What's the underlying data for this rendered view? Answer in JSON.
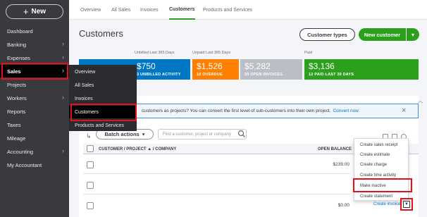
{
  "sidebar": {
    "new_label": "New",
    "items": [
      {
        "label": "Dashboard",
        "chevron": false
      },
      {
        "label": "Banking",
        "chevron": true
      },
      {
        "label": "Expenses",
        "chevron": true
      },
      {
        "label": "Sales",
        "chevron": true
      },
      {
        "label": "Projects",
        "chevron": false
      },
      {
        "label": "Workers",
        "chevron": true
      },
      {
        "label": "Reports",
        "chevron": false
      },
      {
        "label": "Taxes",
        "chevron": false
      },
      {
        "label": "Mileage",
        "chevron": false
      },
      {
        "label": "Accounting",
        "chevron": true
      },
      {
        "label": "My Accountant",
        "chevron": false
      }
    ]
  },
  "submenu": {
    "items": [
      "Overview",
      "All Sales",
      "Invoices",
      "Customers",
      "Products and Services"
    ]
  },
  "tabs": [
    "Overview",
    "All Sales",
    "Invoices",
    "Customers",
    "Products and Services"
  ],
  "page": {
    "title": "Customers",
    "customer_types_label": "Customer types",
    "new_customer_label": "New customer",
    "new_customer_caret": "▾"
  },
  "money_bar": {
    "labels": [
      "Unbilled Last 365 Days",
      "Unpaid Last 365 Days",
      "Paid"
    ],
    "tiles": [
      {
        "amount": "$750",
        "caption": "3 UNBILLED ACTIVITY",
        "color": "#0077c5"
      },
      {
        "amount": "$1,526",
        "caption": "10 OVERDUE",
        "color": "#ff8000"
      },
      {
        "amount": "$5,282",
        "caption": "20 OPEN INVOICES",
        "color": "#babec5"
      },
      {
        "amount": "$3,136",
        "caption": "12 PAID LAST 30 DAYS",
        "color": "#2ca01c"
      }
    ]
  },
  "banner": {
    "text": "customers as projects? You can convert the first level of sub-customers into their own project.",
    "link": "Convert now",
    "close": "×"
  },
  "toolbar": {
    "batch_label": "Batch actions",
    "search_placeholder": "Find a customer, project or company"
  },
  "table": {
    "col_customer": "CUSTOMER / PROJECT ▲ / COMPANY",
    "col_balance": "OPEN BALANCE",
    "balances": [
      "$239.00",
      "",
      "$0.00"
    ],
    "row_action": "Create invoice"
  },
  "dropdown": {
    "items": [
      "Create sales receipt",
      "Create estimate",
      "Create charge",
      "Create time activity",
      "Make inactive",
      "Create statement"
    ]
  },
  "colors": {
    "sidebar_bg": "#393a3d",
    "accent_green": "#2ca01c",
    "highlight_red": "#e5101b",
    "link_blue": "#0077c5"
  }
}
